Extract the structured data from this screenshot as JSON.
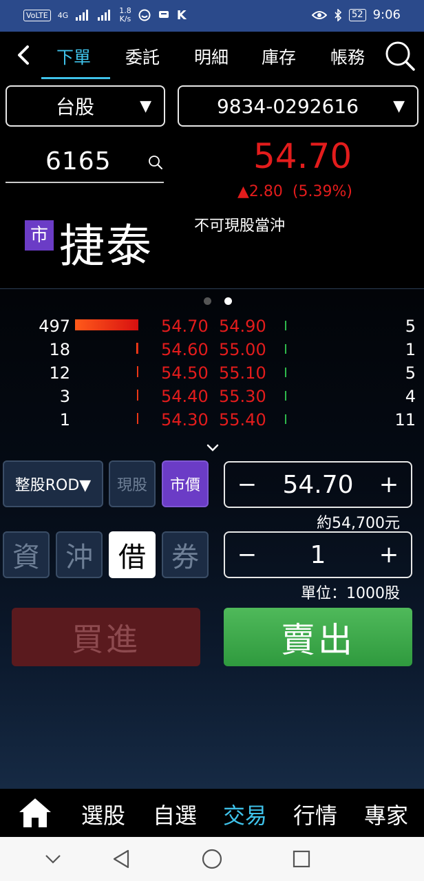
{
  "status_bar": {
    "volte": "VoLTE",
    "network": "4G",
    "speed_value": "1.8",
    "speed_unit": "K/s",
    "battery": "52",
    "time": "9:06"
  },
  "top_nav": {
    "tabs": [
      {
        "label": "下單",
        "active": true
      },
      {
        "label": "委託",
        "active": false
      },
      {
        "label": "明細",
        "active": false
      },
      {
        "label": "庫存",
        "active": false
      },
      {
        "label": "帳務",
        "active": false
      }
    ]
  },
  "market_select": {
    "value": "台股"
  },
  "account_select": {
    "value": "9834-0292616"
  },
  "stock": {
    "code": "6165",
    "market_badge": "市",
    "name": "捷泰",
    "price": "54.70",
    "change": "▲2.80  (5.39%)",
    "note": "不可現股當沖"
  },
  "order_book": {
    "rows": [
      {
        "bid_vol": "497",
        "bid": "54.70",
        "ask": "54.90",
        "ask_vol": "5",
        "bid_bar": 1.0,
        "ask_bar": 0.01
      },
      {
        "bid_vol": "18",
        "bid": "54.60",
        "ask": "55.00",
        "ask_vol": "1",
        "bid_bar": 0.036,
        "ask_bar": 0.01
      },
      {
        "bid_vol": "12",
        "bid": "54.50",
        "ask": "55.10",
        "ask_vol": "5",
        "bid_bar": 0.024,
        "ask_bar": 0.01
      },
      {
        "bid_vol": "3",
        "bid": "54.40",
        "ask": "55.30",
        "ask_vol": "4",
        "bid_bar": 0.006,
        "ask_bar": 0.01
      },
      {
        "bid_vol": "1",
        "bid": "54.30",
        "ask": "55.40",
        "ask_vol": "11",
        "bid_bar": 0.002,
        "ask_bar": 0.022
      }
    ]
  },
  "order_form": {
    "order_type": "整股ROD▼",
    "cash_label": "現股",
    "market_price_label": "市價",
    "price_value": "54.70",
    "minus": "−",
    "plus": "+",
    "approx_amount": "約54,700元",
    "qty_value": "1",
    "unit_text": "單位：1000股",
    "credit_types": [
      "資",
      "沖",
      "借",
      "券"
    ],
    "selected_credit": "借",
    "buy_label": "買進",
    "sell_label": "賣出"
  },
  "bottom_nav": {
    "items": [
      {
        "label": "選股",
        "active": false
      },
      {
        "label": "自選",
        "active": false
      },
      {
        "label": "交易",
        "active": true
      },
      {
        "label": "行情",
        "active": false
      },
      {
        "label": "專家",
        "active": false
      }
    ]
  },
  "colors": {
    "accent": "#3fc2ea",
    "up_red": "#e31c1c",
    "sell_green": "#3fa84b",
    "badge_purple": "#6b3cc6",
    "status_bar": "#2b4a8b"
  }
}
